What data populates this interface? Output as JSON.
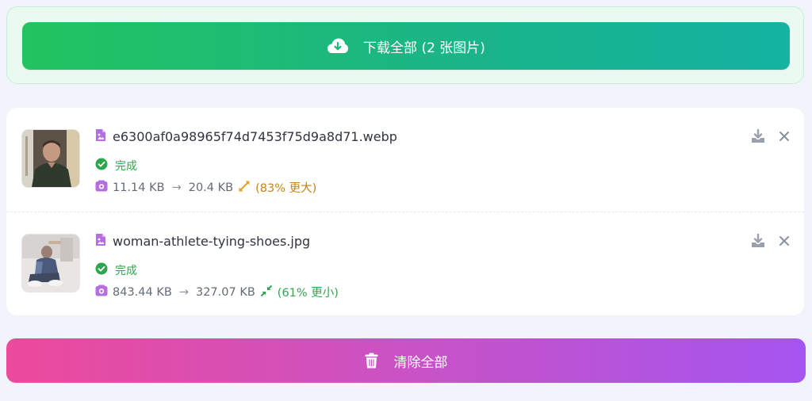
{
  "download_all": {
    "label": "下载全部 (2 张图片)",
    "icon": "cloud-download-icon"
  },
  "files": [
    {
      "name": "e6300af0a98965f74d7453f75d9a8d71.webp",
      "status": "完成",
      "original_size": "11.14 KB",
      "arrow": "→",
      "new_size": "20.4 KB",
      "change": "(83% 更大)",
      "change_kind": "larger",
      "thumbnail": "man-portrait-thumbnail"
    },
    {
      "name": "woman-athlete-tying-shoes.jpg",
      "status": "完成",
      "original_size": "843.44 KB",
      "arrow": "→",
      "new_size": "327.07 KB",
      "change": "(61% 更小)",
      "change_kind": "smaller",
      "thumbnail": "athlete-tying-shoes-thumbnail"
    }
  ],
  "clear_all": {
    "label": "清除全部",
    "icon": "trash-icon"
  },
  "colors": {
    "download_gradient": [
      "#22c35f",
      "#14b3a2"
    ],
    "clear_gradient": [
      "#ec4a9b",
      "#a454f0"
    ],
    "success": "#2fa64d",
    "warning": "#c48416",
    "file_icon": "#b56ee0"
  }
}
